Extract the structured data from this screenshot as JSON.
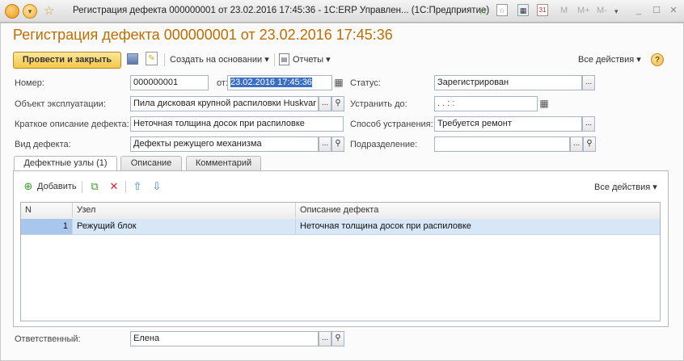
{
  "window": {
    "title": "Регистрация дефекта 000000001 от 23.02.2016 17:45:36 - 1С:ERP Управлен... (1С:Предприятие)",
    "right_icons": [
      "M",
      "M+",
      "M-"
    ]
  },
  "form": {
    "heading": "Регистрация дефекта 000000001 от 23.02.2016 17:45:36",
    "toolbar": {
      "post_close": "Провести и закрыть",
      "create_based": "Создать на основании",
      "reports": "Отчеты",
      "all_actions": "Все действия"
    },
    "fields": {
      "number_label": "Номер:",
      "number_value": "000000001",
      "date_label": "от:",
      "date_value": "23.02.2016 17:45:36",
      "status_label": "Статус:",
      "status_value": "Зарегистрирован",
      "object_label": "Объект эксплуатации:",
      "object_value": "Пила дисковая крупной распиловки Huskvar",
      "fix_until_label": "Устранить до:",
      "fix_until_value": ".  .       :  :",
      "short_desc_label": "Краткое описание дефекта:",
      "short_desc_value": "Неточная толщина досок при распиловке",
      "method_label": "Способ устранения:",
      "method_value": "Требуется ремонт",
      "defect_type_label": "Вид дефекта:",
      "defect_type_value": "Дефекты режущего механизма",
      "department_label": "Подразделение:",
      "department_value": "",
      "responsible_label": "Ответственный:",
      "responsible_value": "Елена"
    },
    "tabs": [
      "Дефектные узлы (1)",
      "Описание",
      "Комментарий"
    ],
    "table": {
      "add_label": "Добавить",
      "all_actions": "Все действия",
      "columns": [
        "N",
        "Узел",
        "Описание дефекта"
      ],
      "rows": [
        {
          "n": "1",
          "node": "Режущий блок",
          "description": "Неточная толщина досок при распиловке"
        }
      ]
    }
  }
}
